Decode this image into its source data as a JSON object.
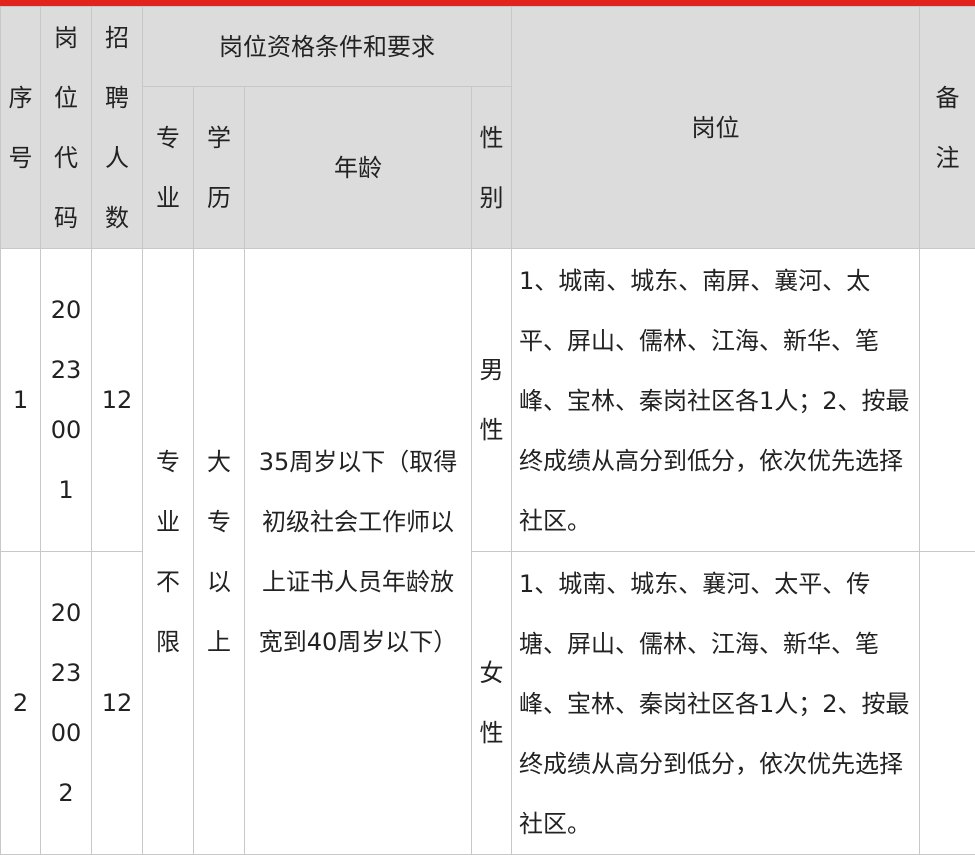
{
  "header": {
    "seq": [
      "序",
      "号"
    ],
    "code": [
      "岗",
      "位",
      "代",
      "码"
    ],
    "count": [
      "招",
      "聘",
      "人",
      "数"
    ],
    "qual_group": "岗位资格条件和要求",
    "major": [
      "专",
      "业"
    ],
    "edu": [
      "学",
      "历"
    ],
    "age": "年龄",
    "gender": [
      "性",
      "别"
    ],
    "position": "岗位",
    "remark": [
      "备",
      "注"
    ]
  },
  "rows": [
    {
      "seq": "1",
      "code": [
        "20",
        "23",
        "00",
        "1"
      ],
      "count": "12",
      "gender": [
        "男",
        "性"
      ],
      "position": "1、城南、城东、南屏、襄河、太平、屏山、儒林、江海、新华、笔峰、宝林、秦岗社区各1人；2、按最终成绩从高分到低分，依次优先选择社区。"
    },
    {
      "seq": "2",
      "code": [
        "20",
        "23",
        "00",
        "2"
      ],
      "count": "12",
      "gender": [
        "女",
        "性"
      ],
      "position": "1、城南、城东、襄河、太平、传塘、屏山、儒林、江海、新华、笔峰、宝林、秦岗社区各1人；2、按最终成绩从高分到低分，依次优先选择社区。"
    }
  ],
  "shared": {
    "major": [
      "专",
      "业",
      "不",
      "限"
    ],
    "edu": [
      "大",
      "专",
      "以",
      "上"
    ],
    "age": "35周岁以下（取得初级社会工作师以上证书人员年龄放宽到40周岁以下）"
  },
  "colors": {
    "top_bar": "#e0231c",
    "header_bg": "#dcdcdc",
    "border": "#c8c8c8"
  }
}
